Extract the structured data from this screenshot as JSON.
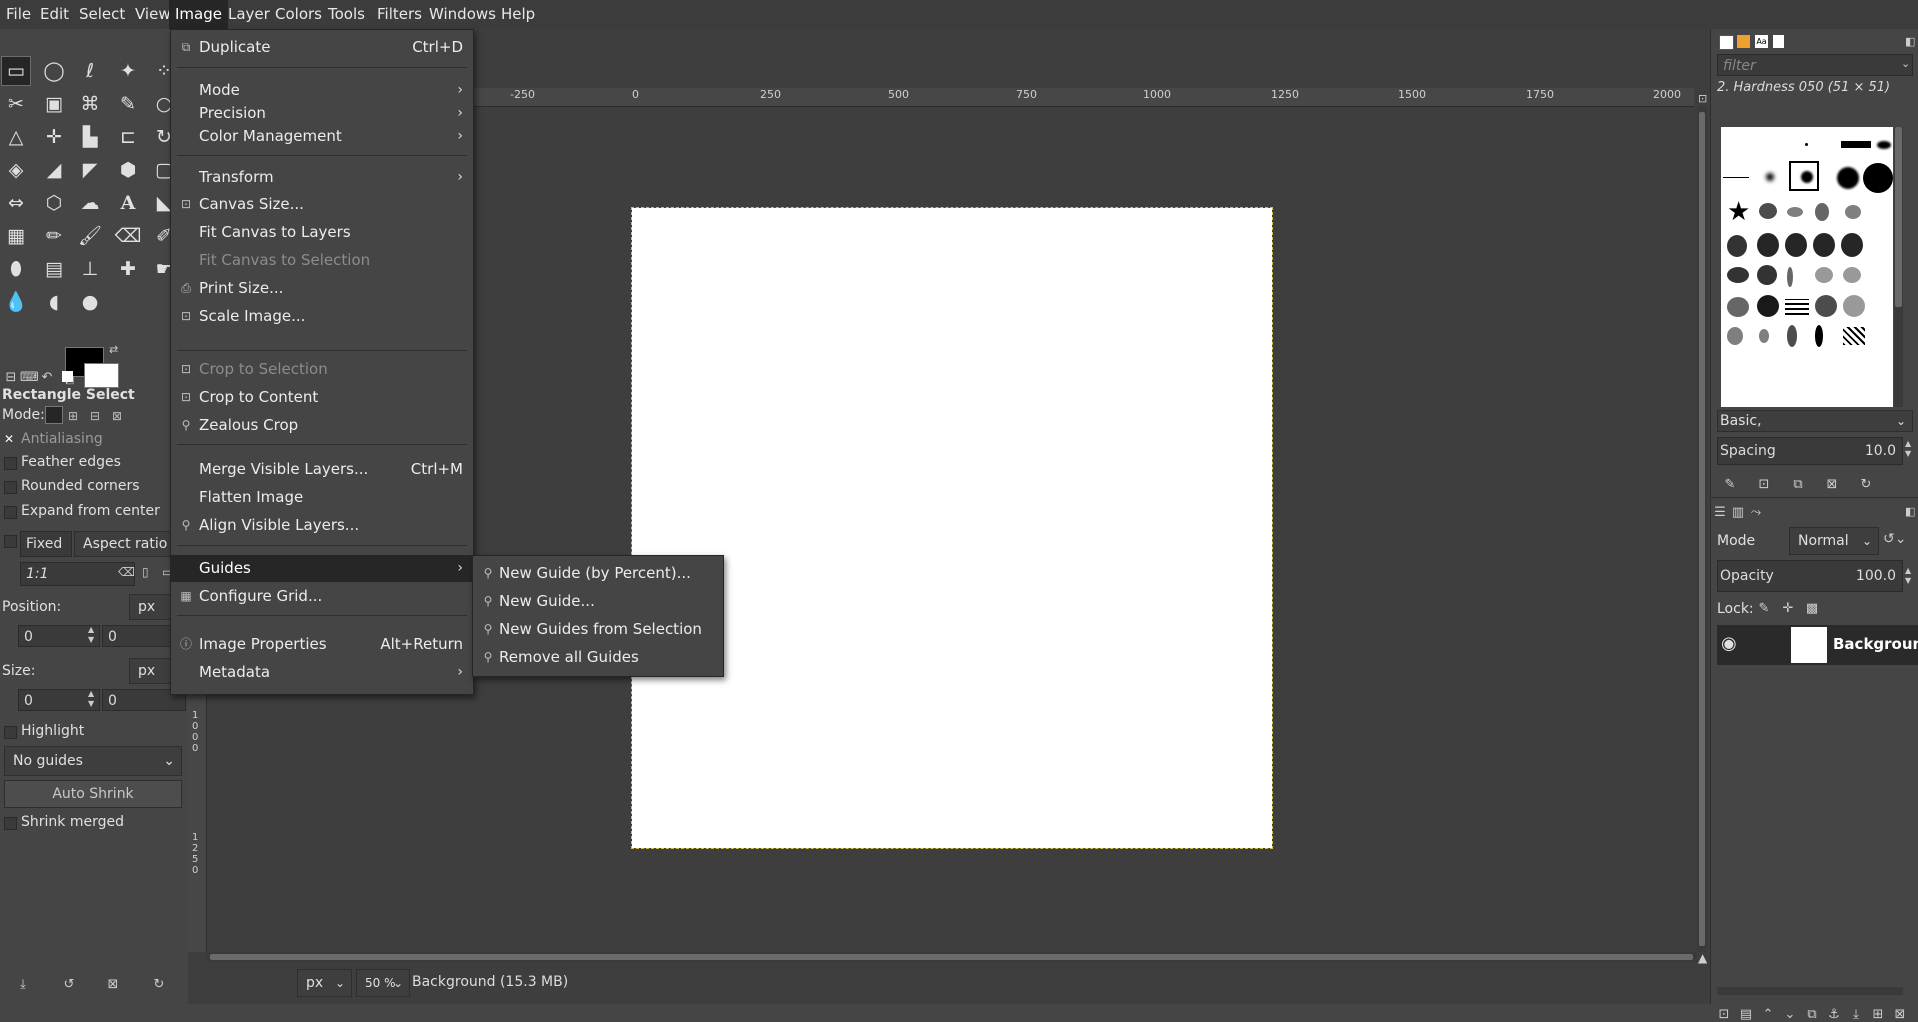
{
  "menubar": {
    "items": [
      "File",
      "Edit",
      "Select",
      "View",
      "Image",
      "Layer",
      "Colors",
      "Tools",
      "Filters",
      "Windows",
      "Help"
    ],
    "active": "Image"
  },
  "image_menu": {
    "items": [
      {
        "label": "Duplicate",
        "shortcut": "Ctrl+D",
        "icon": "duplicate-icon"
      },
      {
        "label": "Mode",
        "submenu": true
      },
      {
        "label": "Precision",
        "submenu": true
      },
      {
        "label": "Color Management",
        "submenu": true
      },
      {
        "label": "Transform",
        "submenu": true
      },
      {
        "label": "Canvas Size...",
        "icon": "canvas-size-icon"
      },
      {
        "label": "Fit Canvas to Layers"
      },
      {
        "label": "Fit Canvas to Selection",
        "disabled": true
      },
      {
        "label": "Print Size...",
        "icon": "print-icon"
      },
      {
        "label": "Scale Image...",
        "icon": "scale-icon"
      },
      {
        "label": "Crop to Selection",
        "disabled": true,
        "icon": "crop-icon"
      },
      {
        "label": "Crop to Content",
        "icon": "crop-icon"
      },
      {
        "label": "Zealous Crop",
        "icon": "plugin-icon"
      },
      {
        "label": "Merge Visible Layers...",
        "shortcut": "Ctrl+M"
      },
      {
        "label": "Flatten Image"
      },
      {
        "label": "Align Visible Layers...",
        "icon": "plugin-icon"
      },
      {
        "label": "Guides",
        "submenu": true,
        "highlighted": true
      },
      {
        "label": "Configure Grid...",
        "icon": "grid-icon"
      },
      {
        "label": "Image Properties",
        "shortcut": "Alt+Return",
        "icon": "info-icon"
      },
      {
        "label": "Metadata",
        "submenu": true
      }
    ]
  },
  "guides_submenu": {
    "items": [
      "New Guide (by Percent)...",
      "New Guide...",
      "New Guides from Selection",
      "Remove all Guides"
    ]
  },
  "toolbox": {
    "tool_name": "Rectangle Select",
    "mode_label": "Mode:",
    "antialiasing": "Antialiasing",
    "feather_edges": "Feather edges",
    "rounded_corners": "Rounded corners",
    "expand_from_center": "Expand from center",
    "fixed": "Fixed",
    "aspect_ratio": "Aspect ratio",
    "ratio_value": "1:1",
    "position_label": "Position:",
    "position_unit": "px",
    "position_x": "0",
    "position_y": "0",
    "size_label": "Size:",
    "size_unit": "px",
    "size_w": "0",
    "size_h": "0",
    "highlight": "Highlight",
    "guides_select": "No guides",
    "auto_shrink": "Auto Shrink",
    "shrink_merged": "Shrink merged"
  },
  "rulers": {
    "horizontal": [
      "-250",
      "0",
      "250",
      "500",
      "750",
      "1000",
      "1250",
      "1500",
      "1750",
      "2000"
    ],
    "vertical_a": "1000",
    "vertical_b": "1250"
  },
  "statusbar": {
    "unit": "px",
    "zoom": "50 %",
    "info": "Background (15.3 MB)"
  },
  "right_dock": {
    "filter_placeholder": "filter",
    "brush_name": "2. Hardness 050 (51 × 51)",
    "brush_set": "Basic,",
    "spacing_label": "Spacing",
    "spacing_value": "10.0",
    "mode_label": "Mode",
    "mode_value": "Normal",
    "opacity_label": "Opacity",
    "opacity_value": "100.0",
    "lock_label": "Lock:",
    "layer_name": "Background"
  },
  "colors": {
    "accent_selection": "#d4c44a",
    "menu_highlight": "#262626"
  }
}
